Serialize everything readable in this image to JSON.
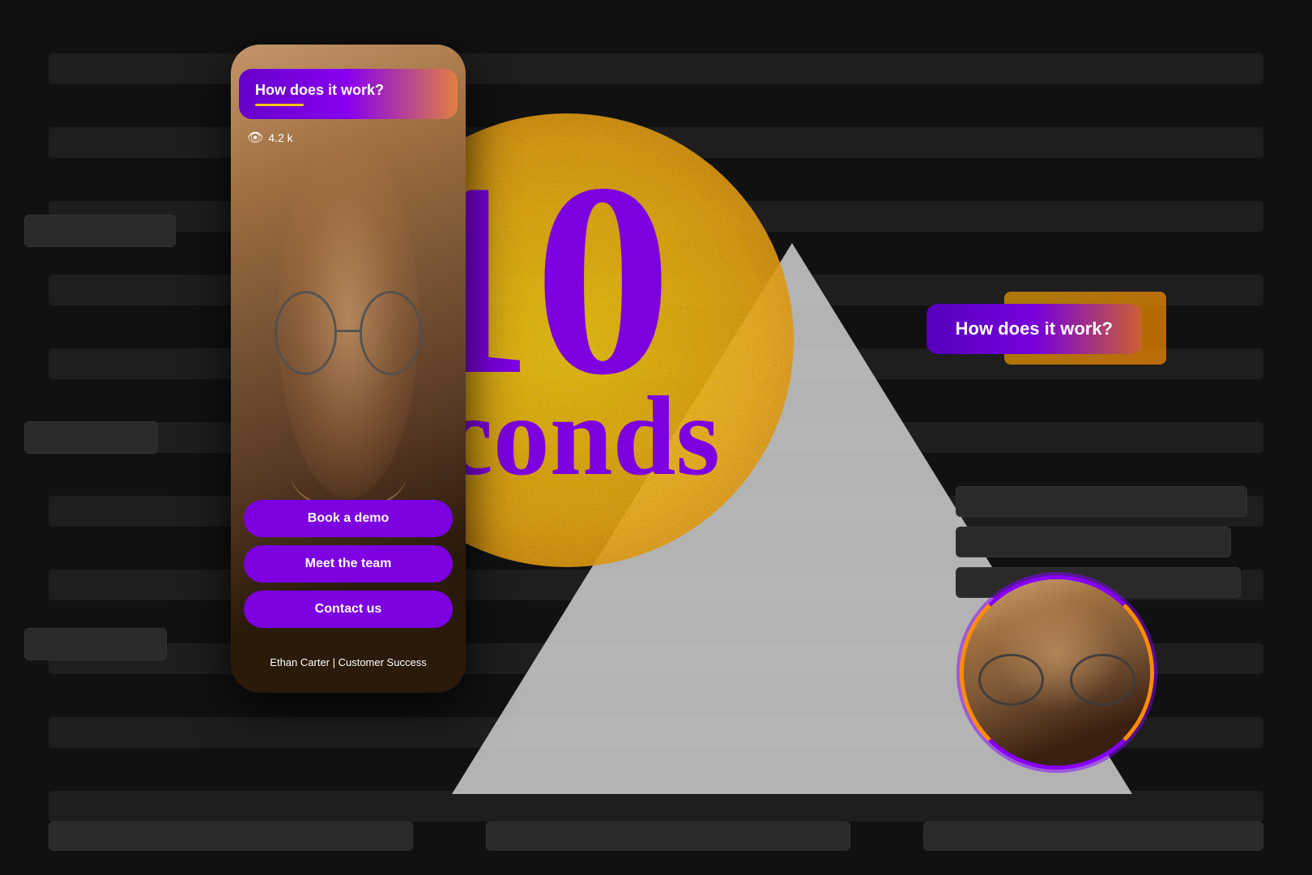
{
  "background": {
    "color": "#111111"
  },
  "phone": {
    "header_title": "How does it work?",
    "view_count": "4.2 k",
    "buttons": [
      {
        "label": "Book a demo",
        "id": "book-demo"
      },
      {
        "label": "Meet the team",
        "id": "meet-team"
      },
      {
        "label": "Contact us",
        "id": "contact-us"
      }
    ],
    "person_label": "Ethan Carter | Customer Success"
  },
  "hero": {
    "number": "10",
    "word": "seconds"
  },
  "how_pill": {
    "label": "How does it work?"
  },
  "colors": {
    "purple": "#7c00e0",
    "gold": "#f5c800",
    "orange": "#e08040",
    "dark": "#111111",
    "btn_bg": "#7c00e0"
  }
}
